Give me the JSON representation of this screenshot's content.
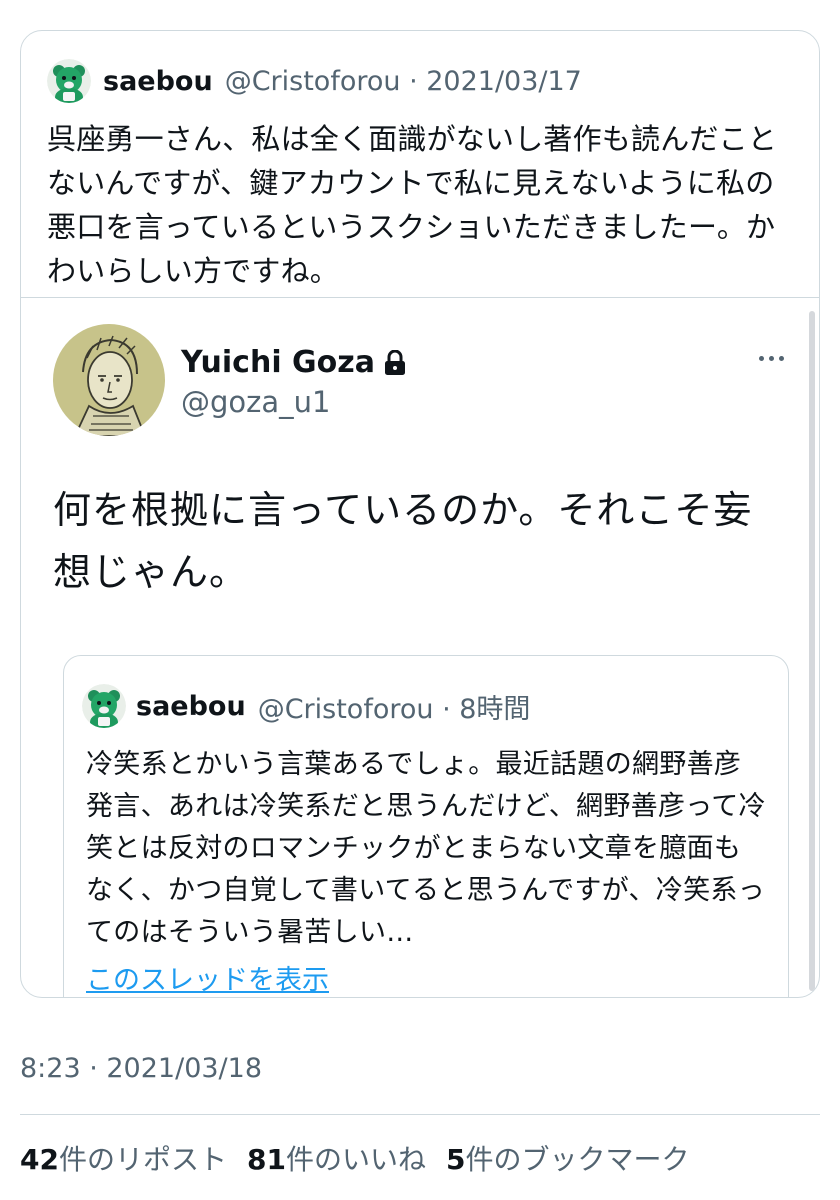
{
  "quote": {
    "author_name": "saebou",
    "handle_date": "@Cristoforou · 2021/03/17",
    "text": "呉座勇一さん、私は全く面識がないし著作も読んだことないんですが、鍵アカウントで私に見えないように私の悪口を言っているというスクショいただきましたー。かわいらしい方ですね。",
    "avatar_icon": "bear-avatar-icon"
  },
  "tweet": {
    "author_name": "Yuichi Goza",
    "handle": "@goza_u1",
    "locked_icon": "lock-icon",
    "more_icon": "more-icon",
    "text": "何を根拠に言っているのか。それこそ妄想じゃん。",
    "avatar_icon": "sketch-portrait-avatar-icon",
    "quoted": {
      "author_name": "saebou",
      "handle_time": "@Cristoforou · 8時間",
      "text": "冷笑系とかいう言葉あるでしょ。最近話題の網野善彦発言、あれは冷笑系だと思うんだけど、網野善彦って冷笑とは反対のロマンチックがとまらない文章を臆面もなく、かつ自覚して書いてると思うんですが、冷笑系ってのはそういう暑苦しい…",
      "show_thread": "このスレッドを表示"
    }
  },
  "timestamp": "8:23 · 2021/03/18",
  "stats": {
    "reposts_count": "42",
    "reposts_label": "件のリポスト",
    "likes_count": "81",
    "likes_label": "件のいいね",
    "bookmarks_count": "5",
    "bookmarks_label": "件のブックマーク"
  },
  "colors": {
    "text": "#0f1419",
    "secondary": "#536471",
    "link": "#1d9bf0",
    "border": "#cfd9de",
    "avatar_bg": "#c7c38a"
  }
}
